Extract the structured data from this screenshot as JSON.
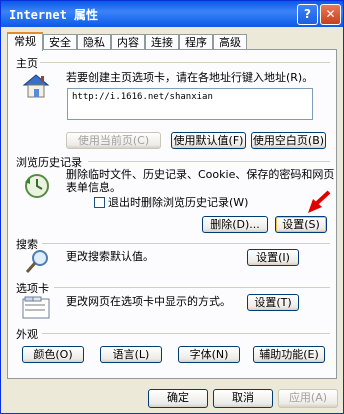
{
  "window": {
    "title": "Internet 属性",
    "help_label": "?",
    "close_label": "✕"
  },
  "tabs": [
    "常规",
    "安全",
    "隐私",
    "内容",
    "连接",
    "程序",
    "高级"
  ],
  "home": {
    "label": "主页",
    "description": "若要创建主页选项卡，请在各地址行键入地址(R)。",
    "url": "http://i.1616.net/shanxian",
    "use_current": "使用当前页(C)",
    "use_default": "使用默认值(F)",
    "use_blank": "使用空白页(B)"
  },
  "history": {
    "label": "浏览历史记录",
    "description_1": "删除临时文件、历史记录、Cookie、保存的密码和网页",
    "description_2": "表单信息。",
    "checkbox_label": "退出时删除浏览历史记录(W)",
    "delete_button": "删除(D)...",
    "settings_button": "设置(S)"
  },
  "search": {
    "label": "搜索",
    "description": "更改搜索默认值。",
    "settings_button": "设置(I)"
  },
  "tabsection": {
    "label": "选项卡",
    "description": "更改网页在选项卡中显示的方式。",
    "settings_button": "设置(T)"
  },
  "appearance": {
    "label": "外观",
    "colors": "颜色(O)",
    "languages": "语言(L)",
    "fonts": "字体(N)",
    "accessibility": "辅助功能(E)"
  },
  "footer": {
    "ok": "确定",
    "cancel": "取消",
    "apply": "应用(A)"
  },
  "colors": {
    "titlebar": "#0a58e8",
    "accent_arrow": "#e00000"
  }
}
